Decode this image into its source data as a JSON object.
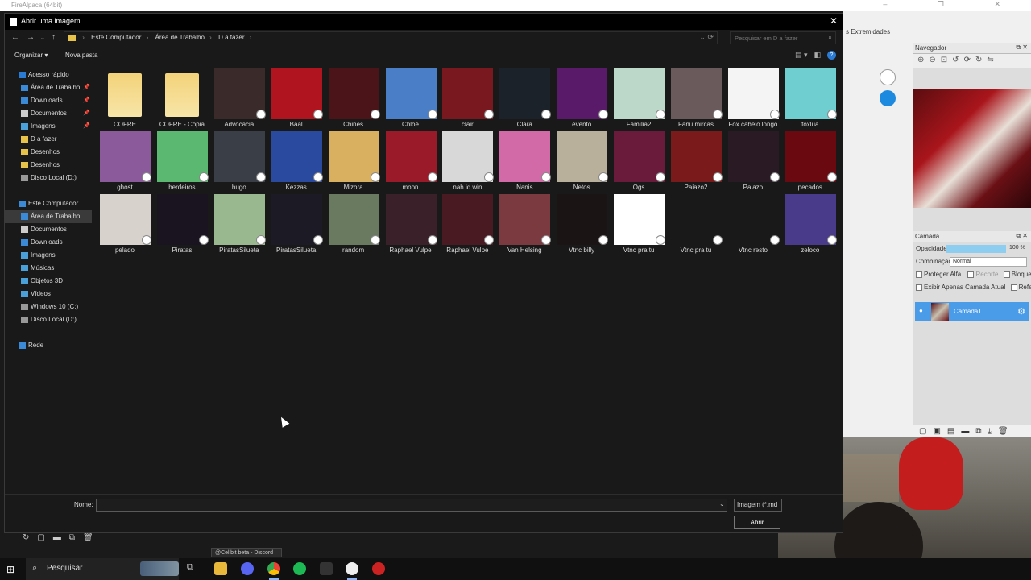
{
  "app": {
    "title": "FireAlpaca (64bit)",
    "strip_label": "s Extremidades"
  },
  "dialog": {
    "title": "Abrir uma imagem",
    "breadcrumbs": [
      "Este Computador",
      "Área de Trabalho",
      "D a fazer"
    ],
    "search_placeholder": "Pesquisar em D a fazer",
    "organize_label": "Organizar",
    "new_folder_label": "Nova pasta",
    "nav_items": [
      {
        "label": "Acesso rápido",
        "icon": "star-icon",
        "level": 0,
        "pinned": false,
        "selected": false
      },
      {
        "label": "Área de Trabalho",
        "icon": "desktop-icon",
        "level": 1,
        "pinned": true,
        "selected": false
      },
      {
        "label": "Downloads",
        "icon": "download-icon",
        "level": 1,
        "pinned": true,
        "selected": false
      },
      {
        "label": "Documentos",
        "icon": "document-icon",
        "level": 1,
        "pinned": true,
        "selected": false
      },
      {
        "label": "Imagens",
        "icon": "image-icon",
        "level": 1,
        "pinned": true,
        "selected": false
      },
      {
        "label": "D a fazer",
        "icon": "folder-icon",
        "level": 1,
        "pinned": false,
        "selected": false
      },
      {
        "label": "Desenhos",
        "icon": "folder-icon",
        "level": 1,
        "pinned": false,
        "selected": false
      },
      {
        "label": "Desenhos",
        "icon": "folder-icon",
        "level": 1,
        "pinned": false,
        "selected": false
      },
      {
        "label": "Disco Local (D:)",
        "icon": "drive-icon",
        "level": 1,
        "pinned": false,
        "selected": false
      },
      {
        "label": "",
        "icon": "",
        "level": 0,
        "pinned": false,
        "selected": false
      },
      {
        "label": "Este Computador",
        "icon": "computer-icon",
        "level": 0,
        "pinned": false,
        "selected": false
      },
      {
        "label": "Área de Trabalho",
        "icon": "desktop-icon",
        "level": 1,
        "pinned": false,
        "selected": true
      },
      {
        "label": "Documentos",
        "icon": "document-icon",
        "level": 1,
        "pinned": false,
        "selected": false
      },
      {
        "label": "Downloads",
        "icon": "download-icon",
        "level": 1,
        "pinned": false,
        "selected": false
      },
      {
        "label": "Imagens",
        "icon": "image-icon",
        "level": 1,
        "pinned": false,
        "selected": false
      },
      {
        "label": "Músicas",
        "icon": "music-icon",
        "level": 1,
        "pinned": false,
        "selected": false
      },
      {
        "label": "Objetos 3D",
        "icon": "cube-icon",
        "level": 1,
        "pinned": false,
        "selected": false
      },
      {
        "label": "Vídeos",
        "icon": "video-icon",
        "level": 1,
        "pinned": false,
        "selected": false
      },
      {
        "label": "Windows 10 (C:)",
        "icon": "drive-icon",
        "level": 1,
        "pinned": false,
        "selected": false
      },
      {
        "label": "Disco Local (D:)",
        "icon": "drive-icon",
        "level": 1,
        "pinned": false,
        "selected": false
      },
      {
        "label": "",
        "icon": "",
        "level": 0,
        "pinned": false,
        "selected": false
      },
      {
        "label": "Rede",
        "icon": "network-icon",
        "level": 0,
        "pinned": false,
        "selected": false
      }
    ],
    "files": [
      {
        "name": "COFRE",
        "kind": "folder",
        "color": "#f3d37a"
      },
      {
        "name": "COFRE - Copia",
        "kind": "folder",
        "color": "#f3d37a"
      },
      {
        "name": "Advocacia",
        "kind": "image",
        "color": "#3b2a2a"
      },
      {
        "name": "Baal",
        "kind": "image",
        "color": "#b0141e"
      },
      {
        "name": "Chines",
        "kind": "image",
        "color": "#4a1418"
      },
      {
        "name": "Chloé",
        "kind": "image",
        "color": "#4a7fc8"
      },
      {
        "name": "clair",
        "kind": "image",
        "color": "#7a1820"
      },
      {
        "name": "Clara",
        "kind": "image",
        "color": "#1c222a"
      },
      {
        "name": "evento",
        "kind": "image",
        "color": "#5a1a6a"
      },
      {
        "name": "Família2",
        "kind": "image",
        "color": "#bcd8c8"
      },
      {
        "name": "Fanu mircas",
        "kind": "image",
        "color": "#6a5a5c"
      },
      {
        "name": "Fox cabelo longo",
        "kind": "image",
        "color": "#f4f4f4"
      },
      {
        "name": "foxlua",
        "kind": "image",
        "color": "#6fcfd0"
      },
      {
        "name": "ghost",
        "kind": "image",
        "color": "#8a5a9a"
      },
      {
        "name": "herdeiros",
        "kind": "image",
        "color": "#5ab870"
      },
      {
        "name": "hugo",
        "kind": "image",
        "color": "#3a3e46"
      },
      {
        "name": "Kezzas",
        "kind": "image",
        "color": "#2a4aa0"
      },
      {
        "name": "Mizora",
        "kind": "image",
        "color": "#d8b060"
      },
      {
        "name": "moon",
        "kind": "image",
        "color": "#9a1a2a"
      },
      {
        "name": "nah id win",
        "kind": "image",
        "color": "#d8d8d8"
      },
      {
        "name": "Nanis",
        "kind": "image",
        "color": "#d26aa8"
      },
      {
        "name": "Netos",
        "kind": "image",
        "color": "#b8b09a"
      },
      {
        "name": "Ogs",
        "kind": "image",
        "color": "#6a1a3a"
      },
      {
        "name": "Paiazo2",
        "kind": "image",
        "color": "#7a1a1a"
      },
      {
        "name": "Palazo",
        "kind": "image",
        "color": "#2a1a24"
      },
      {
        "name": "pecados",
        "kind": "image",
        "color": "#6a0a10"
      },
      {
        "name": "pelado",
        "kind": "image",
        "color": "#d8d2cc"
      },
      {
        "name": "Piratas",
        "kind": "image",
        "color": "#1a1420"
      },
      {
        "name": "PiratasSilueta",
        "kind": "image",
        "color": "#9ab890"
      },
      {
        "name": "PiratasSilueta",
        "kind": "image",
        "color": "#1c1a24"
      },
      {
        "name": "random",
        "kind": "image",
        "color": "#6a7a60"
      },
      {
        "name": "Raphael Vulpe",
        "kind": "image",
        "color": "#3a2028"
      },
      {
        "name": "Raphael Vulpe",
        "kind": "image",
        "color": "#4a1a22"
      },
      {
        "name": "Van Helsing",
        "kind": "image",
        "color": "#7a3a40"
      },
      {
        "name": "Vtnc billy",
        "kind": "image",
        "color": "#1a1414"
      },
      {
        "name": "Vtnc pra tu",
        "kind": "image",
        "color": "#ffffff"
      },
      {
        "name": "Vtnc pra tu",
        "kind": "image",
        "color": "#191919"
      },
      {
        "name": "Vtnc resto",
        "kind": "image",
        "color": "#191919"
      },
      {
        "name": "zeloco",
        "kind": "image",
        "color": "#4a3a8a"
      }
    ],
    "name_label": "Nome:",
    "name_value": "",
    "file_type_label": "Imagem (*.md",
    "open_label": "Abrir"
  },
  "navigator_panel": {
    "title": "Navegador"
  },
  "layer_panel": {
    "title": "Camada",
    "opacity_label": "Opacidade",
    "opacity_value": "100 %",
    "blend_label": "Combinação",
    "blend_value": "Normal",
    "protect_alpha": "Proteger Alfa",
    "clipping": "Recorte",
    "lock": "Bloquear",
    "show_only_layer": "Exibir Apenas Camada Atual",
    "reference": "Referência",
    "layer_name": "Camada1"
  },
  "discord_tooltip": "@Cellbit beta - Discord",
  "taskbar": {
    "search_label": "Pesquisar"
  }
}
